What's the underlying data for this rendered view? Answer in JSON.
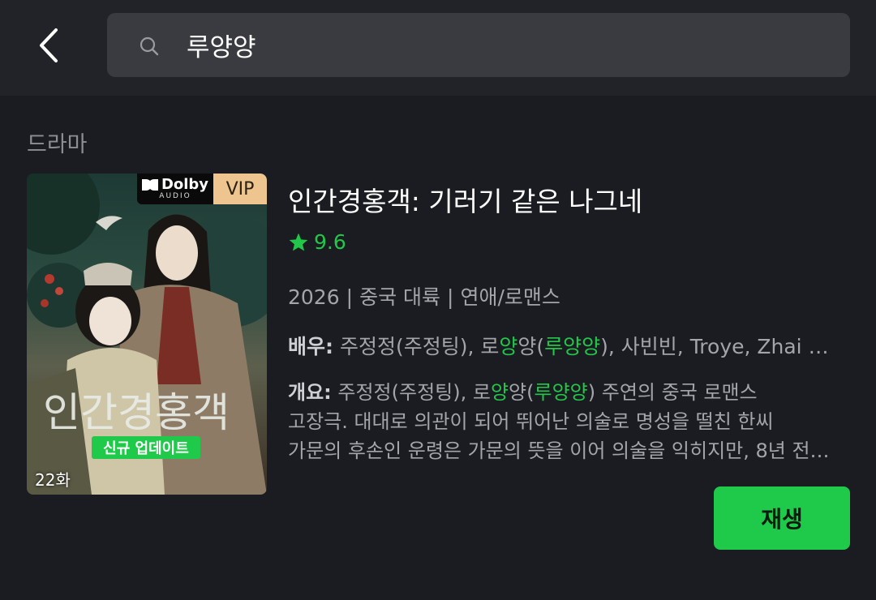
{
  "header": {
    "back_icon": "chevron-left-icon",
    "search": {
      "icon": "search-icon",
      "value": "루양양"
    }
  },
  "section": {
    "title": "드라마"
  },
  "drama": {
    "poster": {
      "dolby_brand": "Dolby",
      "dolby_sub": "AUDIO",
      "vip_label": "VIP",
      "new_badge": "신규 업데이트",
      "episodes": "22화"
    },
    "title": "인간경홍객: 기러기 같은 나그네",
    "rating": "9.6",
    "meta": {
      "year": "2026",
      "sep": "|",
      "region": "중국 대륙",
      "genre": "연애/로맨스"
    },
    "cast": {
      "label": "배우:",
      "parts": [
        " 주정정(주정팅), 로",
        "양",
        "양(",
        "루양양",
        "), 사빈빈, Troye, Zhai …"
      ]
    },
    "synopsis": {
      "label": "개요:",
      "line1_parts": [
        " 주정정(주정팅), 로",
        "양",
        "양(",
        "루양양",
        ") 주연의 중국 로맨스"
      ],
      "line2": "고장극. 대대로 의관이 되어 뛰어난 의술로 명성을 떨친 한씨",
      "line3": "가문의 후손인 운령은 가문의 뜻을 이어 의술을 익히지만, 8년 전…"
    },
    "play_label": "재생"
  },
  "colors": {
    "accent": "#1fc94a",
    "background": "#1b1c21",
    "vip": "#efc58f"
  }
}
